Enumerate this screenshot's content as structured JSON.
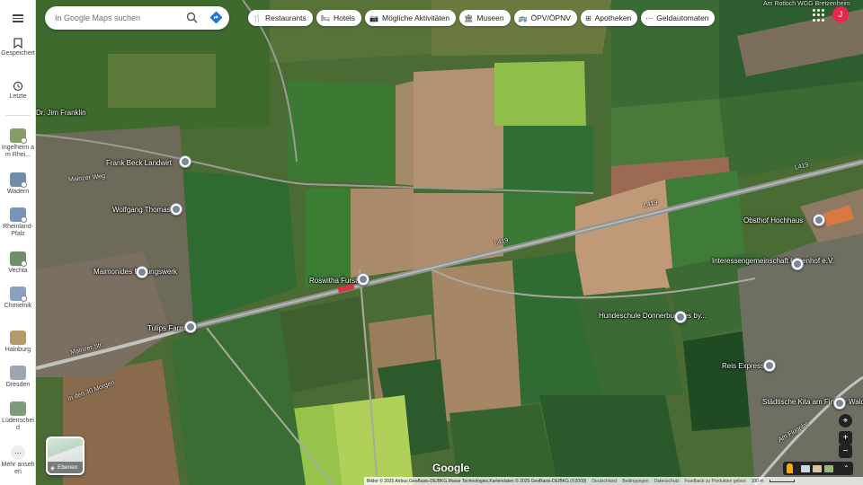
{
  "search": {
    "placeholder": "In Google Maps suchen"
  },
  "chips": [
    {
      "icon": "restaurant-icon",
      "glyph": "🍴",
      "label": "Restaurants"
    },
    {
      "icon": "hotel-icon",
      "glyph": "🛏",
      "label": "Hotels"
    },
    {
      "icon": "camera-icon",
      "glyph": "📷",
      "label": "Mögliche Aktivitäten"
    },
    {
      "icon": "museum-icon",
      "glyph": "🏛",
      "label": "Museen"
    },
    {
      "icon": "transit-icon",
      "glyph": "🚌",
      "label": "ÖPV/ÖPNV"
    },
    {
      "icon": "pharmacy-icon",
      "glyph": "⊞",
      "label": "Apotheken"
    },
    {
      "icon": "atm-icon",
      "glyph": "⋯",
      "label": "Geldautomaten"
    }
  ],
  "rail": {
    "saved_label": "Gespeichert",
    "recent_label": "Letzte",
    "recents": [
      {
        "label": "Ingelheim am Rhei...",
        "color": "#8a9b6a"
      },
      {
        "label": "Wadern",
        "color": "#6f8ca8"
      },
      {
        "label": "Rheinland-Pfalz",
        "color": "#7a94b8"
      },
      {
        "label": "Vechta",
        "color": "#6d8f6a"
      },
      {
        "label": "Chmielnik",
        "color": "#8aa0c0"
      },
      {
        "label": "Hainburg",
        "color": "#b59a6a"
      },
      {
        "label": "Dresden",
        "color": "#9aa6b4"
      },
      {
        "label": "Lüdenscheid",
        "color": "#7f9a7a"
      }
    ],
    "more_label": "Mehr ansehen"
  },
  "avatar": {
    "letter": "J",
    "color": "#e8264f"
  },
  "layers": {
    "label": "Ebenen"
  },
  "map": {
    "places": [
      {
        "text": "Dr. Jim Franklin"
      },
      {
        "text": "Frank Beck Landwirt"
      },
      {
        "text": "Wolfgang Thomas"
      },
      {
        "text": "Maimonides Bildungswerk"
      },
      {
        "text": "Roswitha Furst"
      },
      {
        "text": "Tulips Farm"
      },
      {
        "text": "Obsthof Hochhaus"
      },
      {
        "text": "Interessengemeinschaft Layenhof e.V."
      },
      {
        "text": "Hundeschule Donnerbuddies by..."
      },
      {
        "text": "Reis Express"
      },
      {
        "text": "Städtische Kita am Finther Wald"
      },
      {
        "text": "Am Rotloch WGG Bretzenheim"
      }
    ],
    "roads": [
      "L419",
      "L419",
      "L419",
      "Mainzer Weg",
      "Mainzer Str.",
      "In den 30 Morgen",
      "Am Flugplat"
    ]
  },
  "footer": {
    "google_logo": "Google",
    "attribution": "Bilder © 2025 Airbus,GeoBasis-DE/BKG,Maxar Technologies,Kartendaten © 2025 GeoBasis-DE/BKG (©2009)",
    "links": [
      "Deutschland",
      "Bedingungen",
      "Datenschutz",
      "Feedback zu Produkten geben"
    ],
    "scale": "100 m"
  }
}
